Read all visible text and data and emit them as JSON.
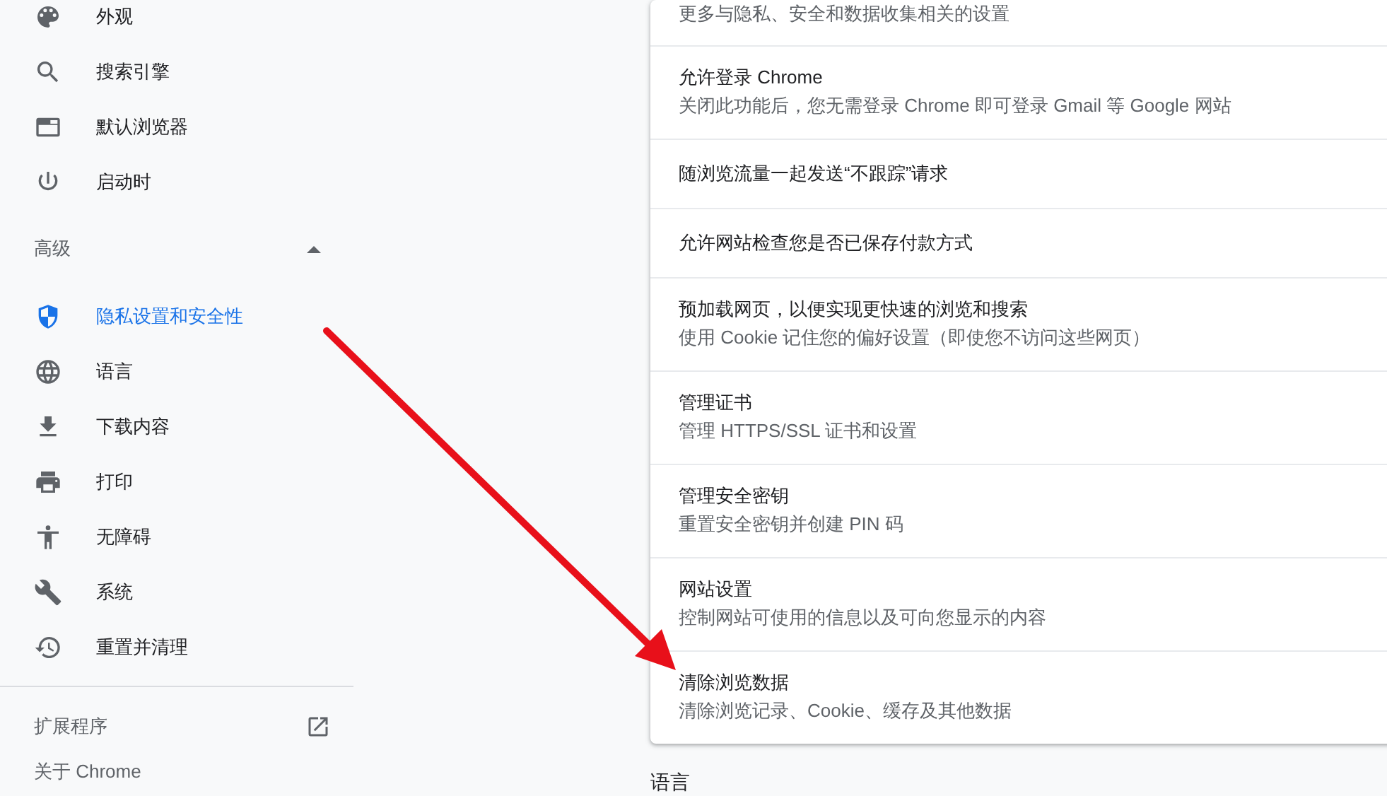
{
  "sidebar": {
    "items": [
      {
        "label": "外观",
        "kind": "palette",
        "selected": false
      },
      {
        "label": "搜索引擎",
        "kind": "search",
        "selected": false
      },
      {
        "label": "默认浏览器",
        "kind": "browser",
        "selected": false
      },
      {
        "label": "启动时",
        "kind": "power",
        "selected": false
      }
    ],
    "advanced": {
      "label": "高级",
      "expanded": true
    },
    "advanced_items": [
      {
        "label": "隐私设置和安全性",
        "kind": "shield",
        "selected": true
      },
      {
        "label": "语言",
        "kind": "globe",
        "selected": false
      },
      {
        "label": "下载内容",
        "kind": "download",
        "selected": false
      },
      {
        "label": "打印",
        "kind": "print",
        "selected": false
      },
      {
        "label": "无障碍",
        "kind": "accessibility",
        "selected": false
      },
      {
        "label": "系统",
        "kind": "wrench",
        "selected": false
      },
      {
        "label": "重置并清理",
        "kind": "history",
        "selected": false
      }
    ],
    "extensions": "扩展程序",
    "about": "关于 Chrome"
  },
  "privacy_card": {
    "rows": [
      {
        "subtitle": "更多与隐私、安全和数据收集相关的设置"
      },
      {
        "title": "允许登录 Chrome",
        "subtitle": "关闭此功能后，您无需登录 Chrome 即可登录 Gmail 等 Google 网站"
      },
      {
        "title": "随浏览流量一起发送“不跟踪”请求"
      },
      {
        "title": "允许网站检查您是否已保存付款方式"
      },
      {
        "title": "预加载网页，以便实现更快速的浏览和搜索",
        "subtitle": "使用 Cookie 记住您的偏好设置（即使您不访问这些网页）"
      },
      {
        "title": "管理证书",
        "subtitle": "管理 HTTPS/SSL 证书和设置"
      },
      {
        "title": "管理安全密钥",
        "subtitle": "重置安全密钥并创建 PIN 码"
      },
      {
        "title": "网站设置",
        "subtitle": "控制网站可使用的信息以及可向您显示的内容"
      },
      {
        "title": "清除浏览数据",
        "subtitle": "清除浏览记录、Cookie、缓存及其他数据"
      }
    ]
  },
  "next_section": {
    "title": "语言"
  }
}
